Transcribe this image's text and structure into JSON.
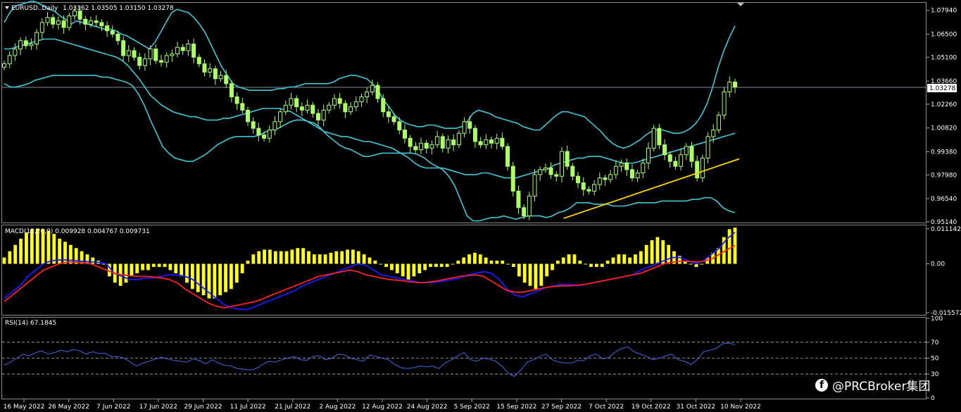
{
  "app": {
    "watermark_icon": "facebook-icon",
    "watermark": "@PRCBroker集团"
  },
  "chart_data": [
    {
      "type": "candlestick",
      "title": "EURUSD..Daily",
      "ohlc_header": "1.03162 1.03505 1.03150 1.03278",
      "current_price": 1.03278,
      "current_price_label": "1.03278",
      "ylim": [
        0.9514,
        1.0835
      ],
      "yticks": [
        "1.07940",
        "1.06500",
        "1.05100",
        "1.03660",
        "1.02260",
        "1.00820",
        "0.99380",
        "0.97980",
        "0.96540",
        "0.95140"
      ],
      "xlabels": [
        "16 May 2022",
        "26 May 2022",
        "7 Jun 2022",
        "17 Jun 2022",
        "29 Jun 2022",
        "11 Jul 2022",
        "21 Jul 2022",
        "2 Aug 2022",
        "12 Aug 2022",
        "24 Aug 2022",
        "5 Sep 2022",
        "15 Sep 2022",
        "27 Sep 2022",
        "7 Oct 2022",
        "19 Oct 2022",
        "31 Oct 2022",
        "10 Nov 2022"
      ],
      "series_keys": {
        "close": [
          1.047,
          1.052,
          1.056,
          1.061,
          1.058,
          1.059,
          1.066,
          1.072,
          1.075,
          1.071,
          1.073,
          1.069,
          1.076,
          1.079,
          1.074,
          1.071,
          1.073,
          1.072,
          1.07,
          1.067,
          1.065,
          1.061,
          1.052,
          1.055,
          1.051,
          1.046,
          1.05,
          1.056,
          1.049,
          1.048,
          1.052,
          1.053,
          1.057,
          1.055,
          1.059,
          1.051,
          1.047,
          1.042,
          1.044,
          1.038,
          1.04,
          1.035,
          1.027,
          1.023,
          1.019,
          1.012,
          1.008,
          1.004,
          1.002,
          1.007,
          1.012,
          1.018,
          1.022,
          1.026,
          1.021,
          1.019,
          1.022,
          1.017,
          1.013,
          1.019,
          1.022,
          1.026,
          1.023,
          1.018,
          1.021,
          1.024,
          1.027,
          1.03,
          1.034,
          1.026,
          1.018,
          1.015,
          1.012,
          1.007,
          1.002,
          0.997,
          0.995,
          0.999,
          0.996,
          0.998,
          1.003,
          0.996,
          1.001,
          0.998,
          1.005,
          1.012,
          1.008,
          1.0,
          0.998,
          1.001,
          0.999,
          1.002,
          0.997,
          0.985,
          0.97,
          0.96,
          0.955,
          0.967,
          0.98,
          0.983,
          0.984,
          0.98,
          0.979,
          0.994,
          0.985,
          0.979,
          0.975,
          0.971,
          0.97,
          0.974,
          0.978,
          0.977,
          0.98,
          0.985,
          0.987,
          0.983,
          0.978,
          0.981,
          0.987,
          0.996,
          1.008,
          0.998,
          0.992,
          0.988,
          0.985,
          0.992,
          0.997,
          0.988,
          0.978,
          0.99,
          1.003,
          1.007,
          1.016,
          1.03,
          1.036,
          1.033
        ],
        "bb_upper": [
          1.072,
          1.078,
          1.082,
          1.083,
          1.084,
          1.085,
          1.084,
          1.082,
          1.08,
          1.079,
          1.076,
          1.074,
          1.071,
          1.073,
          1.072,
          1.071,
          1.07,
          1.069,
          1.068,
          1.068,
          1.067,
          1.065,
          1.064,
          1.062,
          1.06,
          1.058,
          1.056,
          1.06,
          1.066,
          1.072,
          1.078,
          1.08,
          1.079,
          1.078,
          1.075,
          1.071,
          1.066,
          1.059,
          1.052,
          1.045,
          1.04,
          1.035,
          1.033,
          1.032,
          1.031,
          1.031,
          1.031,
          1.031,
          1.031,
          1.032,
          1.032,
          1.033,
          1.033,
          1.034,
          1.035,
          1.035,
          1.035,
          1.035,
          1.035,
          1.036,
          1.038,
          1.039,
          1.04,
          1.04,
          1.039,
          1.038,
          1.035,
          1.031,
          1.025,
          1.021,
          1.016,
          1.013,
          1.011,
          1.01,
          1.009,
          1.009,
          1.01,
          1.01,
          1.009,
          1.008,
          1.008,
          1.008,
          1.009,
          1.012,
          1.017,
          1.019,
          1.018,
          1.017,
          1.015,
          1.014,
          1.013,
          1.012,
          1.011,
          1.009,
          1.008,
          1.007,
          1.007,
          1.01,
          1.013,
          1.016,
          1.018,
          1.018,
          1.017,
          1.016,
          1.015,
          1.012,
          1.009,
          1.006,
          1.002,
          0.999,
          0.997,
          0.996,
          0.997,
          0.999,
          1.001,
          1.004,
          1.006,
          1.007,
          1.007,
          1.006,
          1.005,
          1.005,
          1.006,
          1.008,
          1.011,
          1.016,
          1.023,
          1.033,
          1.045,
          1.055,
          1.063,
          1.07
        ],
        "bb_lower": [
          1.035,
          1.033,
          1.033,
          1.034,
          1.035,
          1.037,
          1.038,
          1.039,
          1.04,
          1.04,
          1.04,
          1.04,
          1.04,
          1.04,
          1.04,
          1.04,
          1.039,
          1.039,
          1.038,
          1.037,
          1.036,
          1.034,
          1.029,
          1.022,
          1.013,
          1.005,
          0.997,
          0.993,
          0.99,
          0.989,
          0.988,
          0.988,
          0.99,
          0.992,
          0.995,
          0.998,
          1.0,
          1.002,
          1.003,
          1.003,
          1.003,
          1.003,
          1.004,
          1.006,
          1.007,
          1.008,
          1.01,
          1.012,
          1.013,
          1.013,
          1.012,
          1.011,
          1.008,
          1.004,
          1.001,
          0.998,
          0.996,
          0.995,
          0.993,
          0.991,
          0.991,
          0.992,
          0.993,
          0.993,
          0.993,
          0.993,
          0.993,
          0.993,
          0.992,
          0.99,
          0.987,
          0.985,
          0.983,
          0.979,
          0.973,
          0.964,
          0.955,
          0.952,
          0.952,
          0.953,
          0.954,
          0.954,
          0.955,
          0.954,
          0.953,
          0.954,
          0.955,
          0.955,
          0.955,
          0.954,
          0.955,
          0.957,
          0.958,
          0.96,
          0.963,
          0.963,
          0.963,
          0.962,
          0.962,
          0.962,
          0.961,
          0.961,
          0.961,
          0.962,
          0.963,
          0.963,
          0.963,
          0.963,
          0.964,
          0.964,
          0.964,
          0.964,
          0.964,
          0.965,
          0.965,
          0.966,
          0.966,
          0.964,
          0.96,
          0.958,
          0.957
        ],
        "bb_mid": [
          1.056,
          1.056,
          1.057,
          1.058,
          1.059,
          1.06,
          1.061,
          1.062,
          1.062,
          1.062,
          1.061,
          1.06,
          1.059,
          1.058,
          1.057,
          1.056,
          1.055,
          1.054,
          1.053,
          1.052,
          1.051,
          1.049,
          1.046,
          1.042,
          1.038,
          1.033,
          1.028,
          1.025,
          1.022,
          1.02,
          1.018,
          1.017,
          1.016,
          1.015,
          1.015,
          1.014,
          1.013,
          1.013,
          1.013,
          1.014,
          1.014,
          1.015,
          1.016,
          1.017,
          1.018,
          1.019,
          1.02,
          1.02,
          1.02,
          1.02,
          1.019,
          1.018,
          1.016,
          1.014,
          1.012,
          1.01,
          1.008,
          1.006,
          1.005,
          1.004,
          1.003,
          1.003,
          1.002,
          1.001,
          1.0,
          1.0,
          0.999,
          0.998,
          0.997,
          0.996,
          0.994,
          0.992,
          0.99,
          0.987,
          0.985,
          0.984,
          0.984,
          0.984,
          0.984,
          0.983,
          0.982,
          0.981,
          0.98,
          0.98,
          0.98,
          0.981,
          0.981,
          0.98,
          0.979,
          0.978,
          0.978,
          0.978,
          0.979,
          0.98,
          0.981,
          0.982,
          0.983,
          0.984,
          0.986,
          0.987,
          0.988,
          0.989,
          0.99,
          0.99,
          0.991,
          0.991,
          0.991,
          0.99,
          0.989,
          0.988,
          0.987,
          0.987,
          0.987,
          0.988,
          0.989,
          0.99,
          0.991,
          0.992,
          0.993,
          0.994,
          0.995,
          0.996,
          0.997,
          0.998,
          0.999,
          1.0,
          1.001,
          1.002,
          1.003,
          1.004,
          1.005
        ]
      },
      "trendline": {
        "color": "#ffd700",
        "from": [
          "27 Sep 2022",
          0.9535
        ],
        "to": [
          "10 Nov 2022",
          0.9895
        ]
      },
      "colors": {
        "candle": "#adff6b",
        "bands": "#40c8d8",
        "price_line": "#7f8c9a",
        "grid": "#ffffff"
      }
    },
    {
      "type": "macd",
      "title": "MACD(12,26,9) 0.009928 0.004767 0.009731",
      "ylim": [
        -0.016,
        0.012
      ],
      "yticks": [
        "0.011142",
        "0.00",
        "-0.015572"
      ],
      "histogram": [
        0.002,
        0.004,
        0.006,
        0.008,
        0.01,
        0.011,
        0.0112,
        0.011,
        0.0105,
        0.0095,
        0.008,
        0.007,
        0.006,
        0.005,
        0.004,
        0.003,
        0.002,
        0.001,
        0.0,
        -0.004,
        -0.006,
        -0.007,
        -0.006,
        -0.004,
        -0.003,
        -0.002,
        -0.002,
        -0.001,
        -0.001,
        -0.001,
        -0.002,
        -0.003,
        -0.004,
        -0.006,
        -0.008,
        -0.009,
        -0.01,
        -0.011,
        -0.011,
        -0.01,
        -0.009,
        -0.008,
        -0.006,
        -0.003,
        0.001,
        0.003,
        0.004,
        0.0045,
        0.0045,
        0.004,
        0.004,
        0.004,
        0.0045,
        0.005,
        0.005,
        0.004,
        0.003,
        0.003,
        0.003,
        0.0035,
        0.004,
        0.004,
        0.0045,
        0.0045,
        0.004,
        0.003,
        0.002,
        0.001,
        0.0,
        -0.001,
        -0.002,
        -0.003,
        -0.004,
        -0.005,
        -0.004,
        -0.003,
        -0.002,
        -0.001,
        -0.001,
        -0.001,
        -0.001,
        0.0,
        0.001,
        0.002,
        0.003,
        0.0035,
        0.003,
        0.002,
        0.001,
        0.001,
        0.001,
        0.0,
        -0.001,
        -0.004,
        -0.006,
        -0.007,
        -0.008,
        -0.007,
        -0.004,
        -0.002,
        0.001,
        0.002,
        0.003,
        0.003,
        0.001,
        0.0,
        -0.001,
        -0.001,
        -0.001,
        0.001,
        0.002,
        0.003,
        0.003,
        0.002,
        0.003,
        0.004,
        0.006,
        0.0075,
        0.0085,
        0.0075,
        0.006,
        0.004,
        0.0025,
        0.001,
        0.0,
        -0.001,
        0.0,
        0.002,
        0.0035,
        0.005,
        0.0085,
        0.011,
        0.0115
      ],
      "macd_line": [
        -0.011,
        -0.009,
        -0.007,
        -0.004,
        -0.002,
        0.0,
        0.001,
        0.0012,
        0.0012,
        0.001,
        0.0008,
        0.0006,
        0.0005,
        0.0,
        -0.003,
        -0.004,
        -0.005,
        -0.005,
        -0.0045,
        -0.0045,
        -0.004,
        -0.0035,
        -0.0035,
        -0.004,
        -0.005,
        -0.007,
        -0.009,
        -0.011,
        -0.013,
        -0.014,
        -0.0145,
        -0.0145,
        -0.0135,
        -0.0125,
        -0.0115,
        -0.0105,
        -0.0095,
        -0.0085,
        -0.007,
        -0.006,
        -0.005,
        -0.004,
        -0.003,
        -0.002,
        -0.001,
        0.0,
        -0.0005,
        -0.002,
        -0.0035,
        -0.004,
        -0.0045,
        -0.005,
        -0.0055,
        -0.006,
        -0.006,
        -0.0058,
        -0.0055,
        -0.005,
        -0.0045,
        -0.0035,
        -0.003,
        -0.0025,
        -0.003,
        -0.005,
        -0.008,
        -0.01,
        -0.0105,
        -0.0095,
        -0.0085,
        -0.0075,
        -0.007,
        -0.0065,
        -0.0065,
        -0.007,
        -0.0065,
        -0.006,
        -0.0055,
        -0.005,
        -0.0045,
        -0.004,
        -0.0035,
        -0.002,
        -0.001,
        0.0,
        0.001,
        0.002,
        0.002,
        0.001,
        0.0,
        0.001,
        0.003,
        0.005,
        0.008,
        0.01
      ],
      "signal_line": [
        -0.012,
        -0.01,
        -0.008,
        -0.006,
        -0.004,
        -0.002,
        -0.001,
        0.0,
        0.0005,
        0.0005,
        0.0003,
        0.0,
        -0.001,
        -0.002,
        -0.003,
        -0.0035,
        -0.0038,
        -0.004,
        -0.004,
        -0.0042,
        -0.0045,
        -0.005,
        -0.006,
        -0.008,
        -0.0095,
        -0.011,
        -0.0125,
        -0.0135,
        -0.014,
        -0.0135,
        -0.013,
        -0.0125,
        -0.012,
        -0.011,
        -0.01,
        -0.009,
        -0.008,
        -0.007,
        -0.006,
        -0.005,
        -0.004,
        -0.0035,
        -0.003,
        -0.0025,
        -0.002,
        -0.0025,
        -0.0035,
        -0.004,
        -0.0045,
        -0.005,
        -0.0052,
        -0.0055,
        -0.0058,
        -0.006,
        -0.0058,
        -0.0055,
        -0.005,
        -0.0045,
        -0.004,
        -0.0038,
        -0.0035,
        -0.004,
        -0.0055,
        -0.007,
        -0.0085,
        -0.009,
        -0.009,
        -0.0085,
        -0.008,
        -0.0075,
        -0.0072,
        -0.007,
        -0.007,
        -0.0068,
        -0.0065,
        -0.006,
        -0.0055,
        -0.005,
        -0.0045,
        -0.004,
        -0.0035,
        -0.003,
        -0.002,
        -0.001,
        0.0,
        0.0005,
        0.0008,
        0.0008,
        0.0006,
        0.0008,
        0.0015,
        0.003,
        0.0045,
        0.0058
      ],
      "colors": {
        "histogram": "#ffff1a",
        "macd": "#1a1aff",
        "signal": "#ff2020"
      }
    },
    {
      "type": "line",
      "title": "RSI(14) 67.1845",
      "ylim": [
        0,
        100
      ],
      "yticks": [
        "100",
        "70",
        "50",
        "30",
        "0"
      ],
      "levels": [
        70,
        50,
        30
      ],
      "values": [
        41,
        45,
        50,
        55,
        53,
        57,
        59,
        55,
        57,
        60,
        58,
        61,
        59,
        55,
        58,
        56,
        56,
        52,
        52,
        50,
        45,
        40,
        44,
        46,
        49,
        51,
        49,
        47,
        46,
        45,
        49,
        47,
        43,
        48,
        44,
        41,
        40,
        37,
        36,
        35,
        37,
        42,
        46,
        45,
        48,
        50,
        52,
        48,
        47,
        52,
        53,
        48,
        50,
        55,
        54,
        50,
        48,
        46,
        54,
        52,
        50,
        48,
        42,
        38,
        37,
        38,
        40,
        39,
        40,
        37,
        44,
        48,
        53,
        57,
        48,
        46,
        50,
        49,
        46,
        40,
        31,
        27,
        35,
        45,
        48,
        52,
        55,
        48,
        45,
        44,
        44,
        47,
        47,
        53,
        55,
        49,
        51,
        58,
        62,
        64,
        58,
        55,
        52,
        48,
        50,
        53,
        55,
        48,
        46,
        42,
        48,
        58,
        60,
        62,
        68,
        69,
        67
      ],
      "colors": {
        "line": "#3d6ae6",
        "levels": "#ffffff"
      }
    }
  ]
}
